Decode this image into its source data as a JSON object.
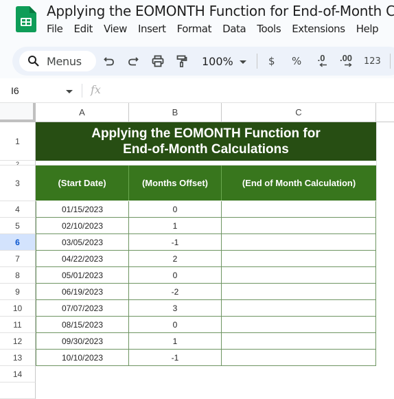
{
  "app": {
    "document_title": "Applying the EOMONTH Function for End-of-Month Cal",
    "menu": [
      "File",
      "Edit",
      "View",
      "Insert",
      "Format",
      "Data",
      "Tools",
      "Extensions",
      "Help"
    ]
  },
  "toolbar": {
    "search_label": "Menus",
    "zoom": "100%",
    "currency": "$",
    "percent": "%",
    "decrease_decimal": ".0",
    "increase_decimal": ".00",
    "number_format": "123"
  },
  "formula_bar": {
    "cell_ref": "I6",
    "fx": "fx",
    "value": ""
  },
  "columns": [
    "A",
    "B",
    "C"
  ],
  "row_numbers": [
    "1",
    "2",
    "3",
    "4",
    "5",
    "6",
    "7",
    "8",
    "9",
    "10",
    "11",
    "12",
    "13",
    "14"
  ],
  "selected_row": "6",
  "sheet": {
    "title_line1": "Applying the EOMONTH Function for",
    "title_line2": "End-of-Month Calculations",
    "headers": [
      "(Start Date)",
      "(Months Offset)",
      "(End of Month Calculation)"
    ],
    "rows": [
      {
        "start_date": "01/15/2023",
        "offset": "0",
        "eom": ""
      },
      {
        "start_date": "02/10/2023",
        "offset": "1",
        "eom": ""
      },
      {
        "start_date": "03/05/2023",
        "offset": "-1",
        "eom": ""
      },
      {
        "start_date": "04/22/2023",
        "offset": "2",
        "eom": ""
      },
      {
        "start_date": "05/01/2023",
        "offset": "0",
        "eom": ""
      },
      {
        "start_date": "06/19/2023",
        "offset": "-2",
        "eom": ""
      },
      {
        "start_date": "07/07/2023",
        "offset": "3",
        "eom": ""
      },
      {
        "start_date": "08/15/2023",
        "offset": "0",
        "eom": ""
      },
      {
        "start_date": "09/30/2023",
        "offset": "1",
        "eom": ""
      },
      {
        "start_date": "10/10/2023",
        "offset": "-1",
        "eom": ""
      }
    ]
  },
  "colors": {
    "title_bg": "#274e13",
    "header_bg": "#38761d",
    "table_border": "#6d9461",
    "selected_row_bg": "#d3e3fd"
  }
}
